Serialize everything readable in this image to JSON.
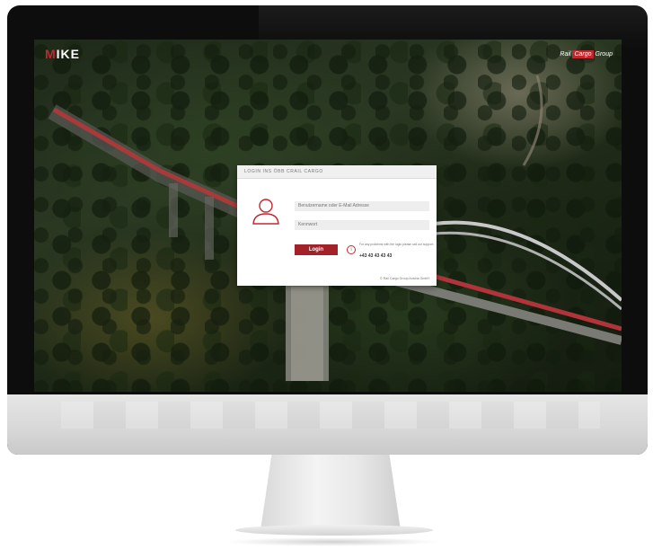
{
  "app": {
    "logo_accent": "M",
    "logo_rest": "IKE",
    "brand_left": "Rail",
    "brand_mid": "Cargo",
    "brand_right": "Group"
  },
  "login": {
    "header": "LOGIN INS ÖBB CRAIL CARGO",
    "username_placeholder": "Benutzername oder E-Mail Adresse",
    "password_placeholder": "Kennwort",
    "button_label": "Login",
    "help_text": "For any problems with the login please call our support:",
    "help_phone": "+43 43 43 43 43",
    "copyright": "© Rail Cargo Group Austria GmbH"
  },
  "colors": {
    "accent": "#c0282e",
    "button": "#a3222a"
  }
}
